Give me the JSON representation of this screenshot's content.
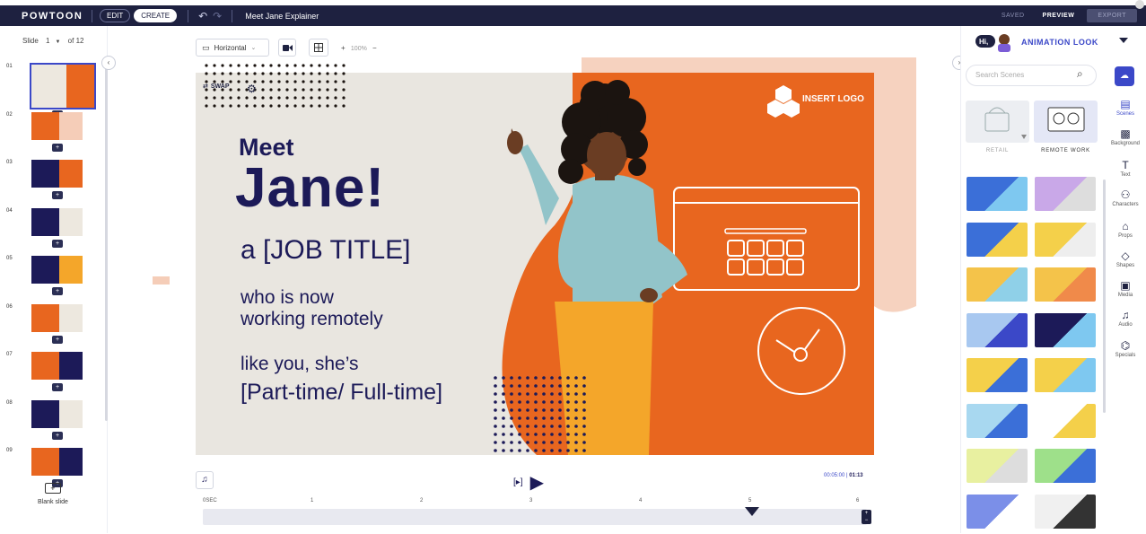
{
  "topbar": {
    "logo": "POWTOON",
    "edit": "EDIT",
    "create": "CREATE",
    "title": "Meet Jane Explainer",
    "saved": "SAVED",
    "preview": "PREVIEW",
    "export": "EXPORT"
  },
  "slides": {
    "label": "Slide",
    "current": "1",
    "total": "of 12",
    "items": [
      {
        "num": "01"
      },
      {
        "num": "02"
      },
      {
        "num": "03"
      },
      {
        "num": "04"
      },
      {
        "num": "05"
      },
      {
        "num": "06"
      },
      {
        "num": "07"
      },
      {
        "num": "08"
      },
      {
        "num": "09"
      }
    ],
    "blank_label": "Blank slide"
  },
  "toolbar": {
    "orientation": "Horizontal",
    "zoom_plus": "+",
    "zoom_pct": "100%",
    "zoom_minus": "−"
  },
  "stage": {
    "swap": "SWAP",
    "meet": "Meet",
    "jane": "Jane!",
    "job": "a [JOB TITLE]",
    "who1": "who is now",
    "who2": "working remotely",
    "like": "like you, she’s",
    "part": "[Part-time/ Full-time]",
    "insert_logo": "INSERT LOGO"
  },
  "playback": {
    "current": "00:05:00",
    "total": "01:13",
    "ticks": [
      "0SEC",
      "1",
      "2",
      "3",
      "4",
      "5",
      "6"
    ]
  },
  "right": {
    "look_label": "ANIMATION LOOK",
    "search_placeholder": "Search Scenes",
    "cat1": "RETAIL",
    "cat2": "REMOTE WORK",
    "tools": [
      "Scenes",
      "Background",
      "Text",
      "Characters",
      "Props",
      "Shapes",
      "Media",
      "Audio",
      "Specials"
    ]
  }
}
